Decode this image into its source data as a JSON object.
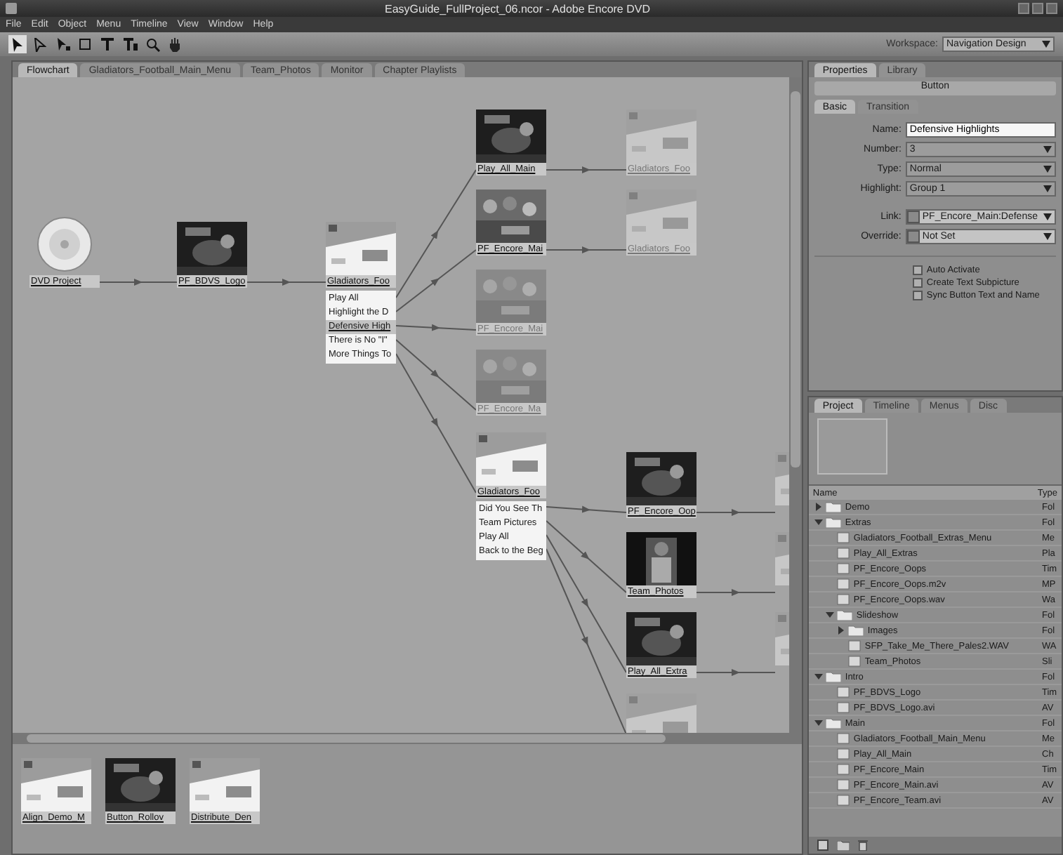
{
  "window": {
    "title": "EasyGuide_FullProject_06.ncor - Adobe Encore DVD"
  },
  "menu_bar": [
    "File",
    "Edit",
    "Object",
    "Menu",
    "Timeline",
    "View",
    "Window",
    "Help"
  ],
  "workspace": {
    "label": "Workspace:",
    "value": "Navigation Design"
  },
  "editor_tabs": [
    {
      "label": "Flowchart",
      "selected": true
    },
    {
      "label": "Gladiators_Football_Main_Menu",
      "selected": false
    },
    {
      "label": "Team_Photos",
      "selected": false
    },
    {
      "label": "Monitor",
      "selected": false
    },
    {
      "label": "Chapter Playlists",
      "selected": false
    }
  ],
  "flowchart": {
    "nodes": [
      {
        "label": "DVD Project",
        "kind": "disc",
        "faded": false
      },
      {
        "label": "PF_BDVS_Logo",
        "kind": "video",
        "faded": false
      },
      {
        "label": "Gladiators_Foo",
        "kind": "menu",
        "faded": false,
        "buttons": [
          {
            "label": "Play All",
            "selected": false
          },
          {
            "label": "Highlight the D",
            "selected": false
          },
          {
            "label": "Defensive High",
            "selected": true
          },
          {
            "label": "There is No \"I\"",
            "selected": false
          },
          {
            "label": "More Things To",
            "selected": false
          }
        ]
      },
      {
        "label": "Play_All_Main",
        "kind": "video",
        "faded": false
      },
      {
        "label": "PF_Encore_Mai",
        "kind": "crowd",
        "faded": false
      },
      {
        "label": "PF_Encore_Mai",
        "kind": "crowd",
        "faded": true
      },
      {
        "label": "PF_Encore_Ma",
        "kind": "crowd",
        "faded": true
      },
      {
        "label": "Gladiators_Foo",
        "kind": "menu",
        "faded": false,
        "buttons": [
          {
            "label": "Did You See Th",
            "selected": false
          },
          {
            "label": "Team Pictures",
            "selected": false
          },
          {
            "label": "Play All",
            "selected": false
          },
          {
            "label": "Back to the Beg",
            "selected": false
          }
        ]
      },
      {
        "label": "Gladiators_Foo",
        "kind": "menu",
        "faded": true
      },
      {
        "label": "Gladiators_Foo",
        "kind": "menu",
        "faded": true
      },
      {
        "label": "PF_Encore_Oop",
        "kind": "video",
        "faded": false
      },
      {
        "label": "Team_Photos",
        "faded": false
      },
      {
        "label": "Play_All_Extra",
        "kind": "video",
        "faded": false
      },
      {
        "kind": "menu",
        "faded": true
      },
      {
        "kind": "menu",
        "faded": true
      },
      {
        "kind": "menu",
        "faded": true
      },
      {
        "kind": "menu",
        "faded": true
      }
    ]
  },
  "library_strip": [
    {
      "label": "Align_Demo_M",
      "kind": "menu"
    },
    {
      "label": "Button_Rollov",
      "kind": "video"
    },
    {
      "label": "Distribute_Den",
      "kind": "menu"
    }
  ],
  "properties": {
    "tabs": [
      {
        "label": "Properties",
        "selected": true
      },
      {
        "label": "Library",
        "selected": false
      }
    ],
    "header": "Button",
    "subtabs": [
      {
        "label": "Basic",
        "selected": true
      },
      {
        "label": "Transition",
        "selected": false
      }
    ],
    "fields": [
      {
        "label": "Name:",
        "kind": "text",
        "value": "Defensive Highlights"
      },
      {
        "label": "Number:",
        "kind": "select",
        "value": "3"
      },
      {
        "label": "Type:",
        "kind": "select",
        "value": "Normal"
      },
      {
        "label": "Highlight:",
        "kind": "select",
        "value": "Group 1"
      },
      {
        "label": "Link:",
        "kind": "link",
        "value": "PF_Encore_Main:Defense"
      },
      {
        "label": "Override:",
        "kind": "link",
        "value": "Not Set"
      }
    ],
    "options": [
      {
        "label": "Auto Activate",
        "checked": false
      },
      {
        "label": "Create Text Subpicture",
        "checked": false
      },
      {
        "label": "Sync Button Text and Name",
        "checked": false
      }
    ]
  },
  "project": {
    "tabs": [
      {
        "label": "Project",
        "selected": true
      },
      {
        "label": "Timeline",
        "selected": false
      },
      {
        "label": "Menus",
        "selected": false
      },
      {
        "label": "Disc",
        "selected": false
      }
    ],
    "columns": [
      "Name",
      "Type"
    ],
    "items": [
      {
        "name": "Demo",
        "type": "Fol",
        "kind": "folder",
        "expanded": false
      },
      {
        "name": "Extras",
        "type": "Fol",
        "kind": "folder",
        "expanded": true,
        "children": [
          {
            "name": "Gladiators_Football_Extras_Menu",
            "type": "Me",
            "kind": "file"
          },
          {
            "name": "Play_All_Extras",
            "type": "Pla",
            "kind": "file"
          },
          {
            "name": "PF_Encore_Oops",
            "type": "Tim",
            "kind": "file"
          },
          {
            "name": "PF_Encore_Oops.m2v",
            "type": "MP",
            "kind": "file"
          },
          {
            "name": "PF_Encore_Oops.wav",
            "type": "Wa",
            "kind": "file"
          },
          {
            "name": "Slideshow",
            "type": "Fol",
            "kind": "folder",
            "expanded": true,
            "children": [
              {
                "name": "Images",
                "type": "Fol",
                "kind": "folder",
                "expanded": false
              },
              {
                "name": "SFP_Take_Me_There_Pales2.WAV",
                "type": "WA",
                "kind": "file"
              },
              {
                "name": "Team_Photos",
                "type": "Sli",
                "kind": "file"
              }
            ]
          }
        ]
      },
      {
        "name": "Intro",
        "type": "Fol",
        "kind": "folder",
        "expanded": true,
        "children": [
          {
            "name": "PF_BDVS_Logo",
            "type": "Tim",
            "kind": "file"
          },
          {
            "name": "PF_BDVS_Logo.avi",
            "type": "AV",
            "kind": "file"
          }
        ]
      },
      {
        "name": "Main",
        "type": "Fol",
        "kind": "folder",
        "expanded": true,
        "children": [
          {
            "name": "Gladiators_Football_Main_Menu",
            "type": "Me",
            "kind": "file"
          },
          {
            "name": "Play_All_Main",
            "type": "Ch",
            "kind": "file"
          },
          {
            "name": "PF_Encore_Main",
            "type": "Tim",
            "kind": "file"
          },
          {
            "name": "PF_Encore_Main.avi",
            "type": "AV",
            "kind": "file"
          },
          {
            "name": "PF_Encore_Team.avi",
            "type": "AV",
            "kind": "file"
          }
        ]
      }
    ]
  }
}
